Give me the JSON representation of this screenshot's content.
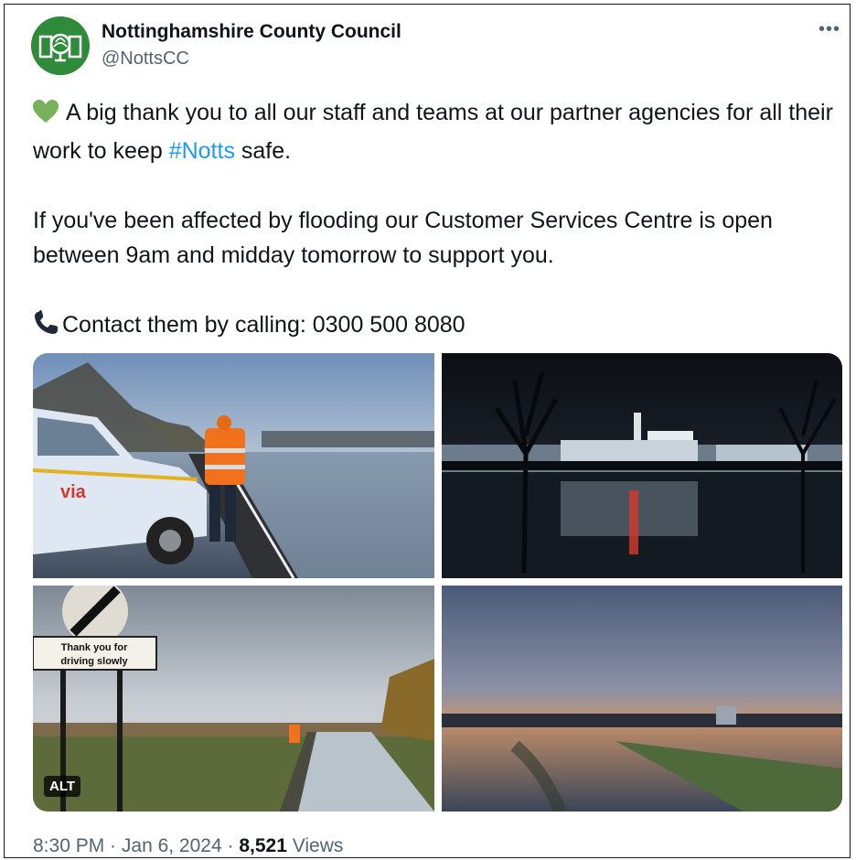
{
  "account": {
    "name": "Nottinghamshire County Council",
    "handle": "@NottsCC"
  },
  "post": {
    "line1_emoji": "green-heart",
    "line1_text": "A big thank you to all our staff and teams at our partner agencies for all their work to keep ",
    "hashtag": "#Notts",
    "line1_tail": " safe.",
    "para2": "If you've been affected by flooding our Customer Services Centre is open between 9am and midday tomorrow to support you.",
    "contact_emoji": "phone",
    "contact_text": "Contact them by calling: 0300 500 8080"
  },
  "media": {
    "sign_line1": "Thank you for",
    "sign_line2": "driving slowly",
    "van_logo": "via",
    "alt_badge": "ALT"
  },
  "footer": {
    "time": "8:30 PM",
    "sep1": " · ",
    "date": "Jan 6, 2024",
    "sep2": " · ",
    "views_count": "8,521",
    "views_label": " Views"
  },
  "colors": {
    "accent": "#1d9bf0",
    "avatar_green": "#2e8b3a",
    "muted": "#536471"
  }
}
